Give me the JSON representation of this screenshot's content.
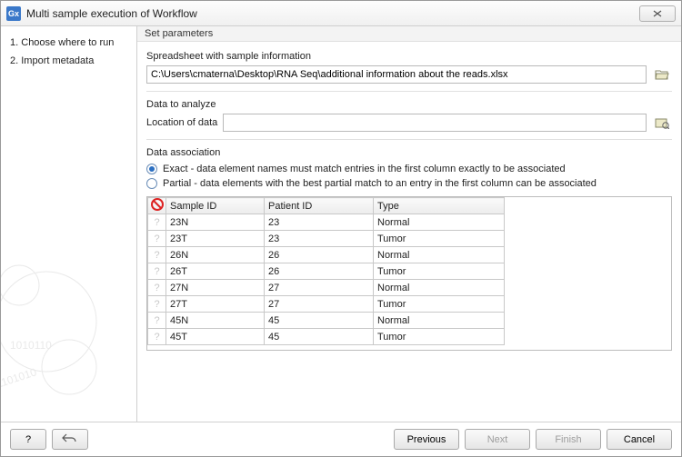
{
  "window": {
    "title": "Multi sample execution of Workflow"
  },
  "sidebar": {
    "items": [
      {
        "num": "1.",
        "label": "Choose where to run"
      },
      {
        "num": "2.",
        "label": "Import metadata"
      }
    ]
  },
  "section_head": "Set parameters",
  "spreadsheet": {
    "label": "Spreadsheet with sample information",
    "value": "C:\\Users\\cmaterna\\Desktop\\RNA Seq\\additional information about the reads.xlsx",
    "browse_icon": "folder-open-icon"
  },
  "analyze": {
    "heading": "Data to analyze",
    "label": "Location of data",
    "value": "",
    "browse_icon": "browse-folder-icon"
  },
  "assoc": {
    "heading": "Data association",
    "exact": "Exact - data element names must match entries in the first column exactly to be associated",
    "partial": "Partial - data elements with the best partial match to an entry in the first column can be associated",
    "selected": "exact"
  },
  "table": {
    "headers": [
      "Sample ID",
      "Patient ID",
      "Type"
    ],
    "rows": [
      {
        "sample": "23N",
        "patient": "23",
        "type": "Normal"
      },
      {
        "sample": "23T",
        "patient": "23",
        "type": "Tumor"
      },
      {
        "sample": "26N",
        "patient": "26",
        "type": "Normal"
      },
      {
        "sample": "26T",
        "patient": "26",
        "type": "Tumor"
      },
      {
        "sample": "27N",
        "patient": "27",
        "type": "Normal"
      },
      {
        "sample": "27T",
        "patient": "27",
        "type": "Tumor"
      },
      {
        "sample": "45N",
        "patient": "45",
        "type": "Normal"
      },
      {
        "sample": "45T",
        "patient": "45",
        "type": "Tumor"
      }
    ]
  },
  "footer": {
    "help": "?",
    "previous": "Previous",
    "next": "Next",
    "finish": "Finish",
    "cancel": "Cancel"
  }
}
